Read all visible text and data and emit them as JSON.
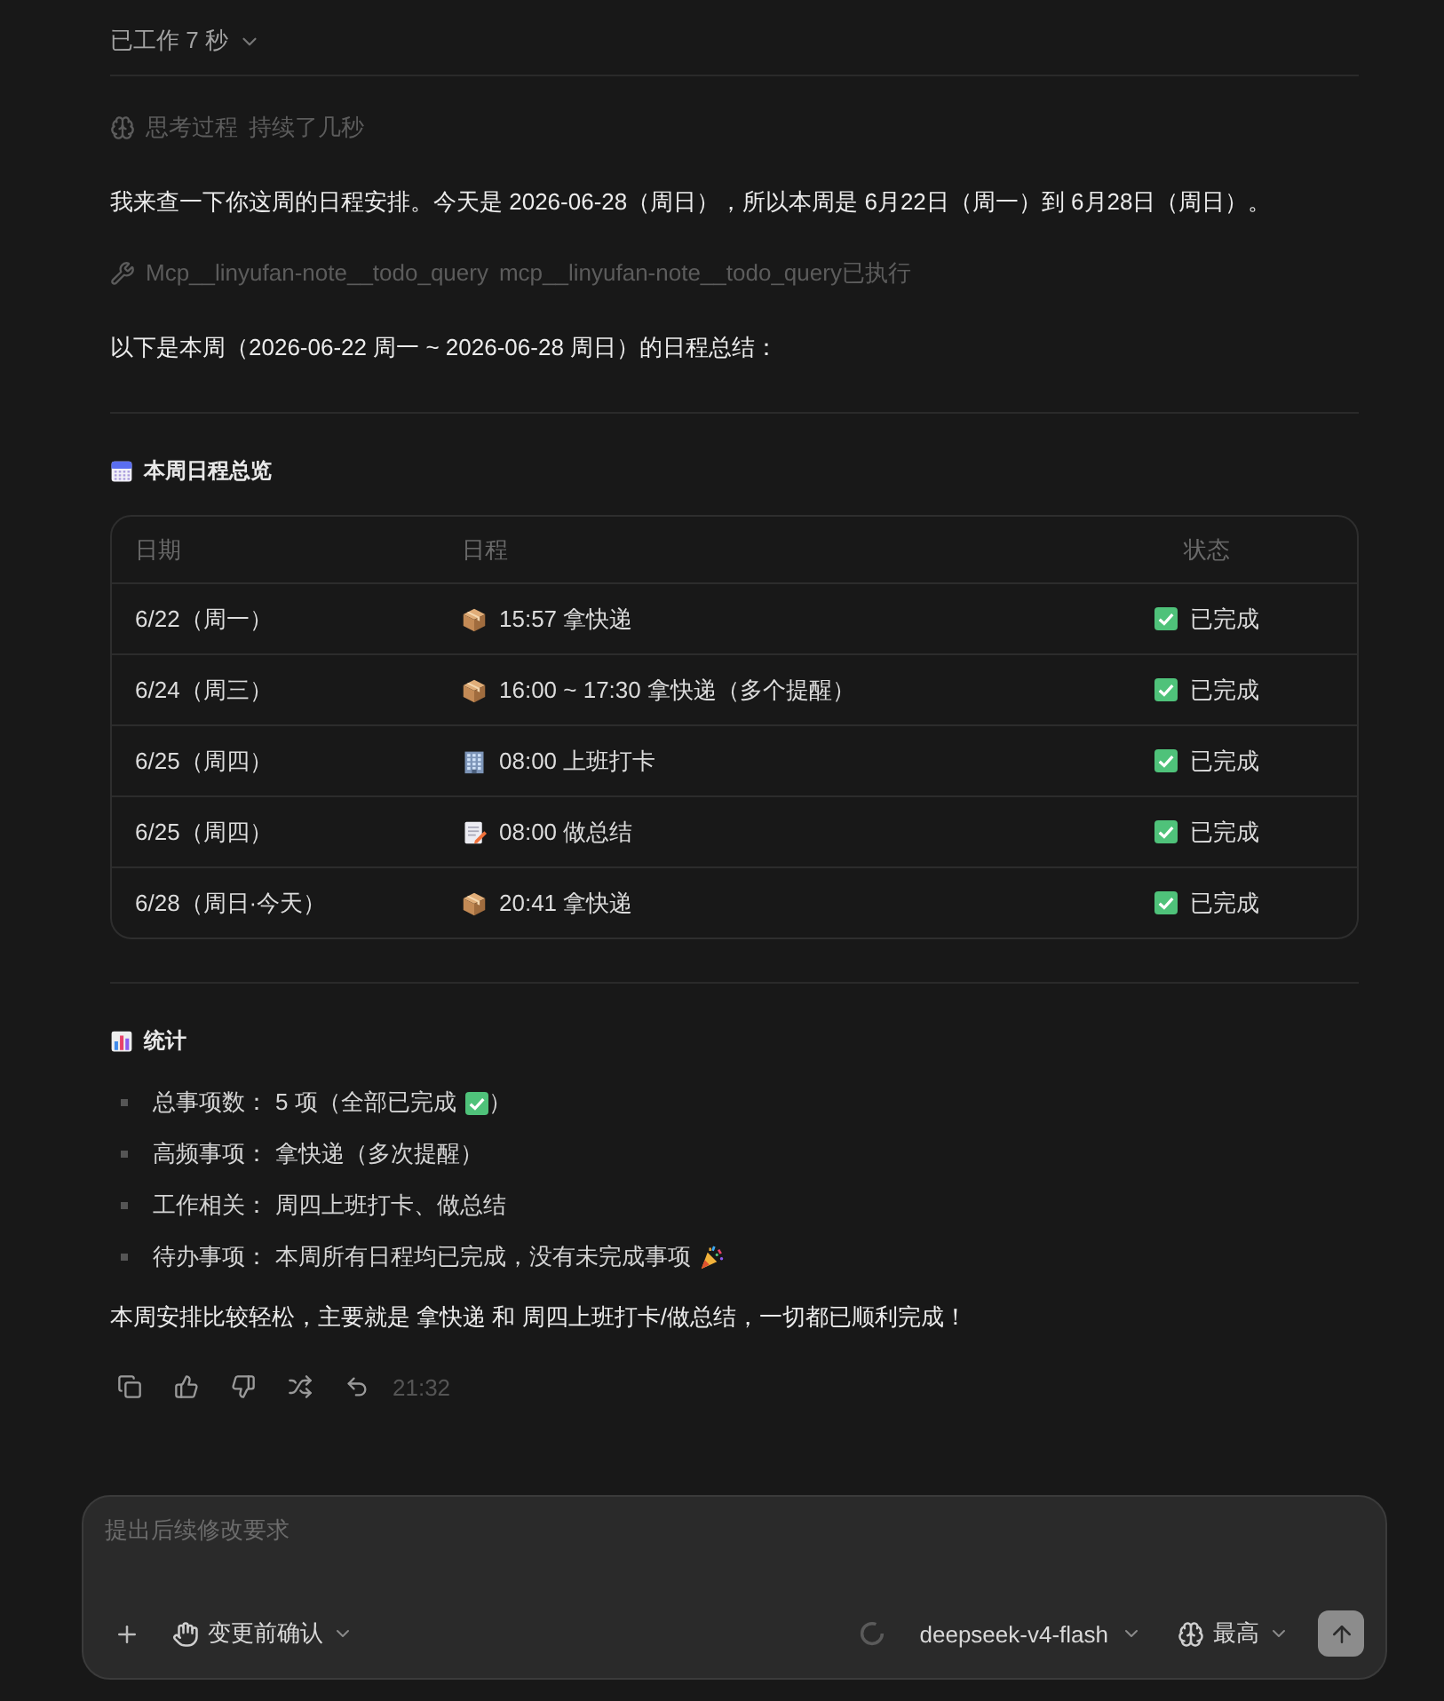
{
  "worklog": {
    "label": "已工作 7 秒"
  },
  "thinking": {
    "label": "思考过程",
    "duration": "持续了几秒"
  },
  "intro": "我来查一下你这周的日程安排。今天是 2026-06-28（周日），所以本周是 6月22日（周一）到 6月28日（周日）。",
  "tool_call": {
    "name": "Mcp__linyufan-note__todo_query",
    "result": "mcp__linyufan-note__todo_query已执行"
  },
  "summary_intro": "以下是本周（2026-06-22 周一 ~ 2026-06-28 周日）的日程总结：",
  "schedule": {
    "heading": "本周日程总览",
    "columns": [
      "日期",
      "日程",
      "状态"
    ],
    "rows": [
      {
        "date": "6/22（周一）",
        "kind": "package",
        "event": "15:57 拿快递",
        "status": "已完成",
        "done": true
      },
      {
        "date": "6/24（周三）",
        "kind": "package",
        "event": "16:00 ~ 17:30 拿快递（多个提醒）",
        "status": "已完成",
        "done": true
      },
      {
        "date": "6/25（周四）",
        "kind": "building",
        "event": "08:00 上班打卡",
        "status": "已完成",
        "done": true
      },
      {
        "date": "6/25（周四）",
        "kind": "memo",
        "event": "08:00 做总结",
        "status": "已完成",
        "done": true
      },
      {
        "date": "6/28（周日·今天）",
        "kind": "package",
        "event": "20:41 拿快递",
        "status": "已完成",
        "done": true
      }
    ]
  },
  "stats": {
    "heading": "统计",
    "items": [
      {
        "label": "总事项数：",
        "value": "5 项（全部已完成",
        "kind": "check",
        "tail": "）"
      },
      {
        "label": "高频事项：",
        "value": "拿快递（多次提醒）",
        "kind": "plain"
      },
      {
        "label": "工作相关：",
        "value": "周四上班打卡、做总结",
        "kind": "plain"
      },
      {
        "label": "待办事项：",
        "value": "本周所有日程均已完成，没有未完成事项",
        "kind": "party"
      }
    ]
  },
  "conclusion": "本周安排比较轻松，主要就是 拿快递 和 周四上班打卡/做总结，一切都已顺利完成！",
  "time": "21:32",
  "composer": {
    "placeholder": "提出后续修改要求",
    "mode": "变更前确认",
    "model": "deepseek-v4-flash",
    "effort": "最高"
  }
}
